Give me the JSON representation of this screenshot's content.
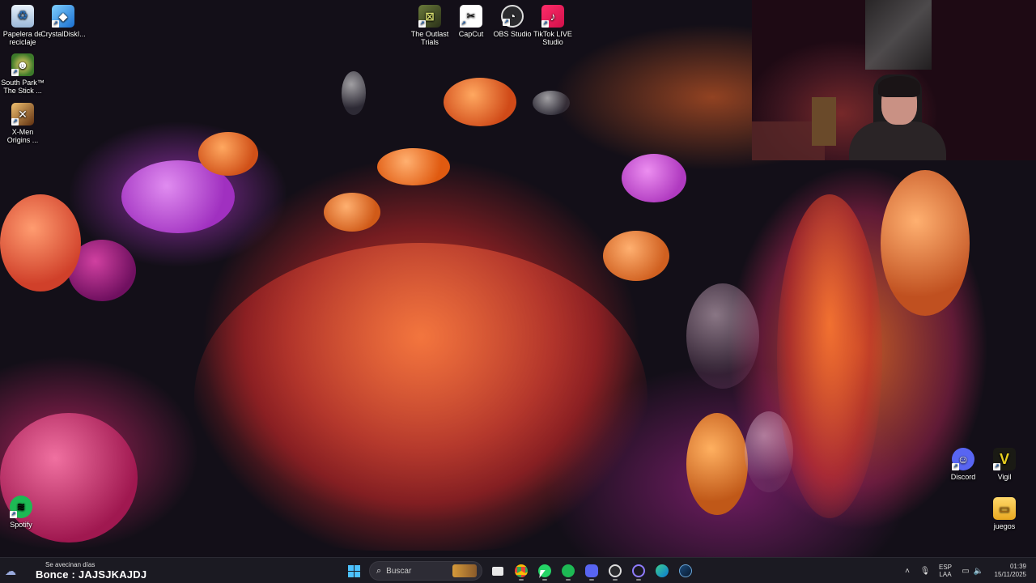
{
  "desktop": {
    "left_icons": [
      {
        "label": "Papelera de reciclaje",
        "icon": "recycle-bin-icon"
      },
      {
        "label": "CrystalDiskI...",
        "icon": "crystaldisk-icon"
      },
      {
        "label": "South Park™ The Stick ...",
        "icon": "south-park-icon"
      },
      {
        "label": "X-Men Origins ...",
        "icon": "xmen-icon"
      },
      {
        "label": "Spotify",
        "icon": "spotify-icon"
      }
    ],
    "top_icons": [
      {
        "label": "The Outlast Trials",
        "icon": "outlast-icon"
      },
      {
        "label": "CapCut",
        "icon": "capcut-icon"
      },
      {
        "label": "OBS Studio",
        "icon": "obs-icon"
      },
      {
        "label": "TikTok LIVE Studio",
        "icon": "tiktok-live-icon"
      }
    ],
    "right_icons": [
      {
        "label": "Discord",
        "icon": "discord-icon"
      },
      {
        "label": "Vigil",
        "icon": "vigil-icon"
      },
      {
        "label": "juegos",
        "icon": "folder-icon"
      }
    ]
  },
  "taskbar": {
    "weather_small": "Se avecinan días",
    "marquee": "Bonce : JAJSJKAJDJ",
    "search_placeholder": "Buscar",
    "apps": [
      "file-explorer-icon",
      "chrome-icon",
      "whatsapp-icon",
      "spotify-icon",
      "discord-icon",
      "obs-icon",
      "app-icon",
      "edge-icon",
      "steam-icon"
    ],
    "lang_top": "ESP",
    "lang_bottom": "LAA",
    "time": "01:39",
    "date": "15/11/2025"
  },
  "colors": {
    "taskbar_bg": "#1b1a22",
    "windows_blue": "#4cc2ff",
    "spotify_green": "#1db954",
    "discord_blurple": "#5865f2"
  }
}
